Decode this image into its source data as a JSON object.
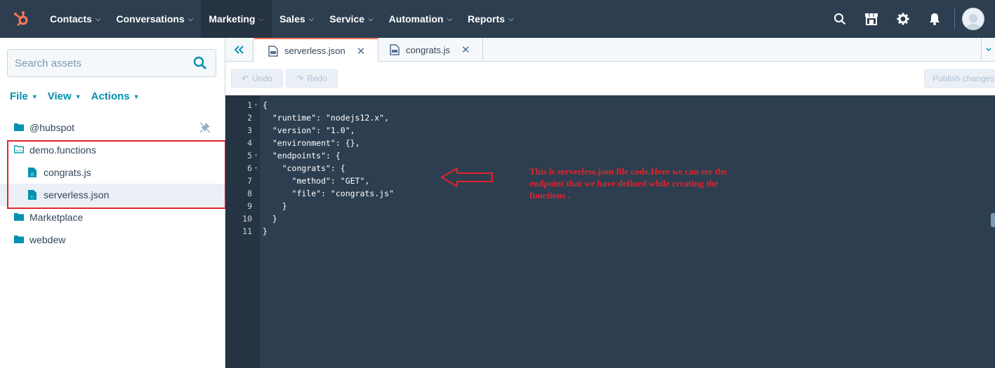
{
  "topnav": {
    "items": [
      {
        "label": "Contacts",
        "active": false
      },
      {
        "label": "Conversations",
        "active": false
      },
      {
        "label": "Marketing",
        "active": true
      },
      {
        "label": "Sales",
        "active": false
      },
      {
        "label": "Service",
        "active": false
      },
      {
        "label": "Automation",
        "active": false
      },
      {
        "label": "Reports",
        "active": false
      }
    ],
    "icons": [
      "search-icon",
      "marketplace-icon",
      "gear-icon",
      "bell-icon"
    ],
    "brand_color": "#ff7a59",
    "bg_color": "#2d3e50"
  },
  "sidebar": {
    "search_placeholder": "Search assets",
    "menu": {
      "file": "File",
      "view": "View",
      "actions": "Actions"
    },
    "tree": [
      {
        "label": "@hubspot",
        "type": "folder",
        "level": 0
      },
      {
        "label": "demo.functions",
        "type": "functions-folder",
        "level": 0
      },
      {
        "label": "congrats.js",
        "type": "js-file",
        "level": 1
      },
      {
        "label": "serverless.json",
        "type": "json-file",
        "level": 1,
        "selected": true
      },
      {
        "label": "Marketplace",
        "type": "folder",
        "level": 0
      },
      {
        "label": "webdew",
        "type": "folder",
        "level": 0
      }
    ]
  },
  "tabs": [
    {
      "label": "serverless.json",
      "active": true
    },
    {
      "label": "congrats.js",
      "active": false
    }
  ],
  "toolbar": {
    "undo": "Undo",
    "redo": "Redo",
    "publish": "Publish changes"
  },
  "code": {
    "lines": [
      "{",
      "  \"runtime\": \"nodejs12.x\",",
      "  \"version\": \"1.0\",",
      "  \"environment\": {},",
      "  \"endpoints\": {",
      "    \"congrats\": {",
      "      \"method\": \"GET\",",
      "      \"file\": \"congrats.js\"",
      "    }",
      "  }",
      "}"
    ],
    "foldable": [
      1,
      5,
      6
    ]
  },
  "annotation": {
    "text": "This is serverless.json file code.Here we can see the endpoint that we have defined while creating the functions .",
    "color": "#e0242b"
  }
}
